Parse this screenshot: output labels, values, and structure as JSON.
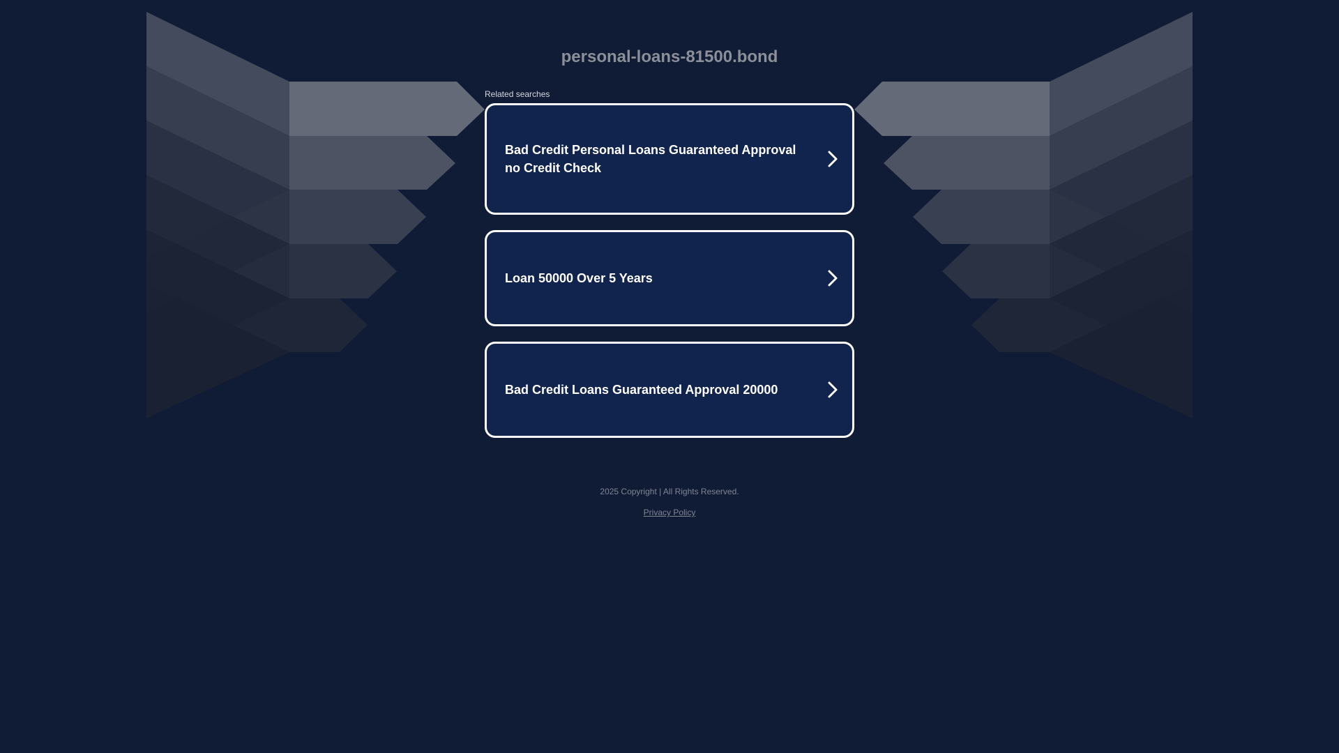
{
  "header": {
    "domain": "personal-loans-81500.bond"
  },
  "related": {
    "label": "Related searches",
    "items": [
      {
        "label": "Bad Credit Personal Loans Guaranteed Approval no Credit Check"
      },
      {
        "label": "Loan 50000 Over 5 Years"
      },
      {
        "label": "Bad Credit Loans Guaranteed Approval 20000"
      }
    ]
  },
  "footer": {
    "copyright": "2025 Copyright | All Rights Reserved.",
    "privacy": "Privacy Policy"
  },
  "colors": {
    "background": "#101c36",
    "card": "#11244d",
    "card_border": "#ffffff",
    "title": "#8b8f98",
    "footer_text": "#808592"
  },
  "icons": {
    "card_arrow": "chevron-right-icon"
  }
}
